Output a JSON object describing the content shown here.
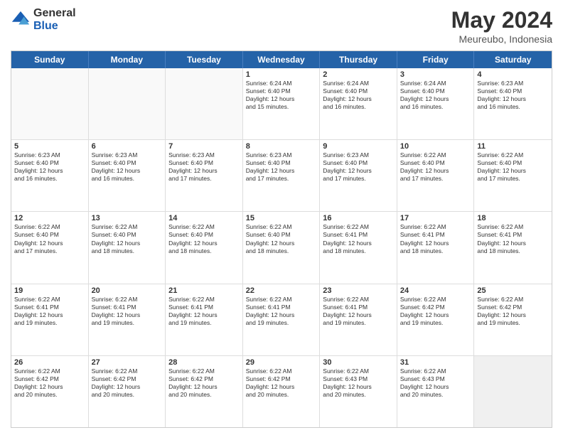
{
  "logo": {
    "general": "General",
    "blue": "Blue"
  },
  "title": {
    "month": "May 2024",
    "location": "Meureubo, Indonesia"
  },
  "header_days": [
    "Sunday",
    "Monday",
    "Tuesday",
    "Wednesday",
    "Thursday",
    "Friday",
    "Saturday"
  ],
  "rows": [
    [
      {
        "day": "",
        "info": ""
      },
      {
        "day": "",
        "info": ""
      },
      {
        "day": "",
        "info": ""
      },
      {
        "day": "1",
        "info": "Sunrise: 6:24 AM\nSunset: 6:40 PM\nDaylight: 12 hours\nand 15 minutes."
      },
      {
        "day": "2",
        "info": "Sunrise: 6:24 AM\nSunset: 6:40 PM\nDaylight: 12 hours\nand 16 minutes."
      },
      {
        "day": "3",
        "info": "Sunrise: 6:24 AM\nSunset: 6:40 PM\nDaylight: 12 hours\nand 16 minutes."
      },
      {
        "day": "4",
        "info": "Sunrise: 6:23 AM\nSunset: 6:40 PM\nDaylight: 12 hours\nand 16 minutes."
      }
    ],
    [
      {
        "day": "5",
        "info": "Sunrise: 6:23 AM\nSunset: 6:40 PM\nDaylight: 12 hours\nand 16 minutes."
      },
      {
        "day": "6",
        "info": "Sunrise: 6:23 AM\nSunset: 6:40 PM\nDaylight: 12 hours\nand 16 minutes."
      },
      {
        "day": "7",
        "info": "Sunrise: 6:23 AM\nSunset: 6:40 PM\nDaylight: 12 hours\nand 17 minutes."
      },
      {
        "day": "8",
        "info": "Sunrise: 6:23 AM\nSunset: 6:40 PM\nDaylight: 12 hours\nand 17 minutes."
      },
      {
        "day": "9",
        "info": "Sunrise: 6:23 AM\nSunset: 6:40 PM\nDaylight: 12 hours\nand 17 minutes."
      },
      {
        "day": "10",
        "info": "Sunrise: 6:22 AM\nSunset: 6:40 PM\nDaylight: 12 hours\nand 17 minutes."
      },
      {
        "day": "11",
        "info": "Sunrise: 6:22 AM\nSunset: 6:40 PM\nDaylight: 12 hours\nand 17 minutes."
      }
    ],
    [
      {
        "day": "12",
        "info": "Sunrise: 6:22 AM\nSunset: 6:40 PM\nDaylight: 12 hours\nand 17 minutes."
      },
      {
        "day": "13",
        "info": "Sunrise: 6:22 AM\nSunset: 6:40 PM\nDaylight: 12 hours\nand 18 minutes."
      },
      {
        "day": "14",
        "info": "Sunrise: 6:22 AM\nSunset: 6:40 PM\nDaylight: 12 hours\nand 18 minutes."
      },
      {
        "day": "15",
        "info": "Sunrise: 6:22 AM\nSunset: 6:40 PM\nDaylight: 12 hours\nand 18 minutes."
      },
      {
        "day": "16",
        "info": "Sunrise: 6:22 AM\nSunset: 6:41 PM\nDaylight: 12 hours\nand 18 minutes."
      },
      {
        "day": "17",
        "info": "Sunrise: 6:22 AM\nSunset: 6:41 PM\nDaylight: 12 hours\nand 18 minutes."
      },
      {
        "day": "18",
        "info": "Sunrise: 6:22 AM\nSunset: 6:41 PM\nDaylight: 12 hours\nand 18 minutes."
      }
    ],
    [
      {
        "day": "19",
        "info": "Sunrise: 6:22 AM\nSunset: 6:41 PM\nDaylight: 12 hours\nand 19 minutes."
      },
      {
        "day": "20",
        "info": "Sunrise: 6:22 AM\nSunset: 6:41 PM\nDaylight: 12 hours\nand 19 minutes."
      },
      {
        "day": "21",
        "info": "Sunrise: 6:22 AM\nSunset: 6:41 PM\nDaylight: 12 hours\nand 19 minutes."
      },
      {
        "day": "22",
        "info": "Sunrise: 6:22 AM\nSunset: 6:41 PM\nDaylight: 12 hours\nand 19 minutes."
      },
      {
        "day": "23",
        "info": "Sunrise: 6:22 AM\nSunset: 6:41 PM\nDaylight: 12 hours\nand 19 minutes."
      },
      {
        "day": "24",
        "info": "Sunrise: 6:22 AM\nSunset: 6:42 PM\nDaylight: 12 hours\nand 19 minutes."
      },
      {
        "day": "25",
        "info": "Sunrise: 6:22 AM\nSunset: 6:42 PM\nDaylight: 12 hours\nand 19 minutes."
      }
    ],
    [
      {
        "day": "26",
        "info": "Sunrise: 6:22 AM\nSunset: 6:42 PM\nDaylight: 12 hours\nand 20 minutes."
      },
      {
        "day": "27",
        "info": "Sunrise: 6:22 AM\nSunset: 6:42 PM\nDaylight: 12 hours\nand 20 minutes."
      },
      {
        "day": "28",
        "info": "Sunrise: 6:22 AM\nSunset: 6:42 PM\nDaylight: 12 hours\nand 20 minutes."
      },
      {
        "day": "29",
        "info": "Sunrise: 6:22 AM\nSunset: 6:42 PM\nDaylight: 12 hours\nand 20 minutes."
      },
      {
        "day": "30",
        "info": "Sunrise: 6:22 AM\nSunset: 6:43 PM\nDaylight: 12 hours\nand 20 minutes."
      },
      {
        "day": "31",
        "info": "Sunrise: 6:22 AM\nSunset: 6:43 PM\nDaylight: 12 hours\nand 20 minutes."
      },
      {
        "day": "",
        "info": ""
      }
    ]
  ]
}
